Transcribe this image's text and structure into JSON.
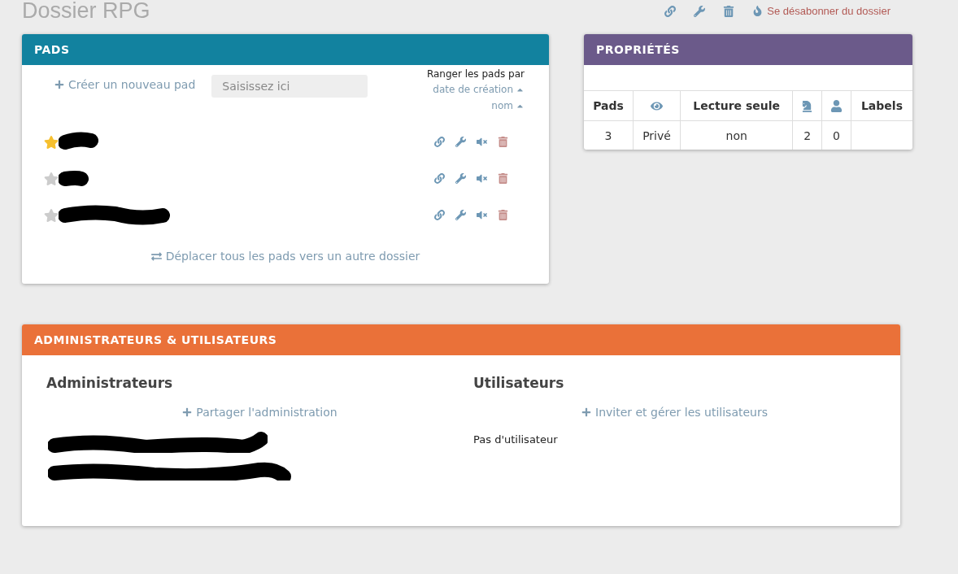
{
  "title": "Dossier RPG",
  "top_actions": {
    "unsubscribe": "Se désabonner du dossier"
  },
  "pads_panel": {
    "title": "PADS",
    "create_label": "Créer un nouveau pad",
    "search": {
      "placeholder": "Saisissez ici"
    },
    "sort": {
      "label": "Ranger les pads par",
      "options": [
        "date de création",
        "nom"
      ]
    },
    "pads": [
      {
        "starred": true,
        "kind": "short"
      },
      {
        "starred": false,
        "kind": "tiny"
      },
      {
        "starred": false,
        "kind": "long"
      }
    ],
    "move_all": "Déplacer tous les pads vers un autre dossier"
  },
  "properties_panel": {
    "title": "PROPRIÉTÉS",
    "columns": [
      {
        "kind": "text",
        "label": "Pads"
      },
      {
        "kind": "eye"
      },
      {
        "kind": "text",
        "label": "Lecture seule"
      },
      {
        "kind": "admin"
      },
      {
        "kind": "user"
      },
      {
        "kind": "text",
        "label": "Labels"
      }
    ],
    "row": [
      "3",
      "Privé",
      "non",
      "2",
      "0"
    ]
  },
  "members_panel": {
    "title": "ADMINISTRATEURS & UTILISATEURS",
    "admins": {
      "heading": "Administrateurs",
      "action": "Partager l'administration",
      "entries": [
        {
          "kind": "admin"
        },
        {
          "kind": "admin2"
        }
      ]
    },
    "users": {
      "heading": "Utilisateurs",
      "action": "Inviter et gérer les utilisateurs",
      "empty": "Pas d'utilisateur"
    }
  }
}
